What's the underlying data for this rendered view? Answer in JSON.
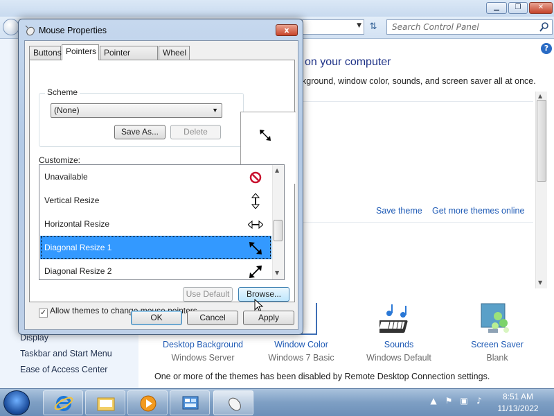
{
  "control_panel": {
    "search_placeholder": "Search Control Panel",
    "heading": "on your computer",
    "subtitle": "kground, window color, sounds, and screen saver all at once.",
    "save_theme": "Save theme",
    "more_themes": "Get more themes online",
    "left_links": [
      "Display",
      "Taskbar and Start Menu",
      "Ease of Access Center"
    ],
    "tiles": [
      {
        "title": "Desktop Background",
        "value": "Windows Server"
      },
      {
        "title": "Window Color",
        "value": "Windows 7 Basic"
      },
      {
        "title": "Sounds",
        "value": "Windows Default"
      },
      {
        "title": "Screen Saver",
        "value": "Blank"
      }
    ],
    "remote_note": "One or more of the themes has been disabled by Remote Desktop Connection settings.",
    "help": "?"
  },
  "dialog": {
    "title": "Mouse Properties",
    "close": "x",
    "tabs": [
      "Buttons",
      "Pointers",
      "Pointer Options",
      "Wheel"
    ],
    "active_tab": "Pointers",
    "scheme_label": "Scheme",
    "scheme_value": "(None)",
    "save_as": "Save As...",
    "delete": "Delete",
    "customize_label": "Customize:",
    "cursors": [
      {
        "label": "Unavailable",
        "icon": "unavailable-cursor-icon"
      },
      {
        "label": "Vertical Resize",
        "icon": "vertical-resize-cursor-icon"
      },
      {
        "label": "Horizontal Resize",
        "icon": "horizontal-resize-cursor-icon"
      },
      {
        "label": "Diagonal Resize 1",
        "icon": "diagonal-resize-1-cursor-icon",
        "selected": true
      },
      {
        "label": "Diagonal Resize 2",
        "icon": "diagonal-resize-2-cursor-icon"
      }
    ],
    "use_default": "Use Default",
    "browse": "Browse...",
    "allow_themes": "Allow themes to change mouse pointers",
    "allow_themes_checked": true,
    "ok": "OK",
    "cancel": "Cancel",
    "apply": "Apply"
  },
  "taskbar": {
    "time": "8:51 AM",
    "date": "11/13/2022"
  }
}
